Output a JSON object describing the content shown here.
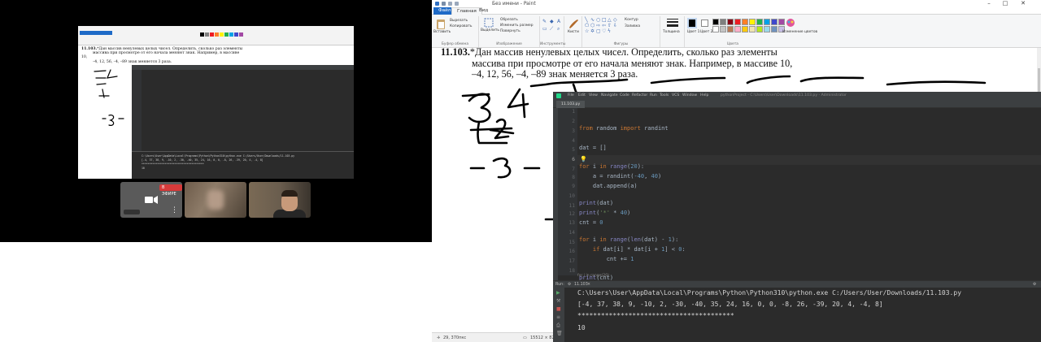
{
  "paint": {
    "title": "Без имени - Paint",
    "tabs": [
      {
        "label": "Файл"
      },
      {
        "label": "Главная"
      },
      {
        "label": "Вид"
      }
    ],
    "ribbon": {
      "paste_label": "Вставить",
      "cut_label": "Вырезать",
      "copy_label": "Копировать",
      "clipboard_group": "Буфер обмена",
      "select_label": "Выделить",
      "crop_label": "Обрезать",
      "resize_label": "Изменить размер",
      "rotate_label": "Повернуть",
      "image_group": "Изображение",
      "tools_group": "Инструменты",
      "brushes_label": "Кисти",
      "outline_label": "Контур",
      "fill_label": "Заливка",
      "shapes_group": "Фигуры",
      "thickness_label": "Толщина",
      "color1_label": "Цвет 1",
      "color2_label": "Цвет 2",
      "edit_colors_label": "Изменение цветов",
      "colors_group": "Цвета",
      "palette": [
        "#000000",
        "#7f7f7f",
        "#880015",
        "#ed1c24",
        "#ff7f27",
        "#fff200",
        "#22b14c",
        "#00a2e8",
        "#3f48cc",
        "#a349a4",
        "#ffffff",
        "#c3c3c3",
        "#b97a57",
        "#ffaec9",
        "#ffc90e",
        "#efe4b0",
        "#b5e61d",
        "#99d9ea",
        "#7092be",
        "#c8bfe7"
      ]
    },
    "task": {
      "number": "11.103.",
      "line1": "*Дан массив ненулевых целых чисел. Определить, сколько раз элементы",
      "line2": "массива при просмотре от его начала меняют знак. Например, в массиве 10,",
      "line3": "–4, 12, 56, –4, –89 знак меняется 3 раза."
    },
    "status": {
      "cursor": "29, 370пкс",
      "selection": "15512 × 8210"
    }
  },
  "ide": {
    "menu": [
      "File",
      "Edit",
      "View",
      "Navigate",
      "Code",
      "Refactor",
      "Run",
      "Tools",
      "VCS",
      "Window",
      "Help"
    ],
    "project_title": "pythonProject - C:\\Users\\User\\Downloads\\11.103.py - Administrator",
    "file_tab": "11.103.py",
    "line_numbers": [
      "1",
      "2",
      "3",
      "4",
      "5",
      "6",
      "7",
      "8",
      "9",
      "10",
      "11",
      "12",
      "13",
      "14",
      "15",
      "16",
      "17",
      "18"
    ],
    "breadcrumb": "for i in range(20)",
    "run_label": "Run:",
    "run_config": "11.103",
    "output": {
      "command": "C:\\Users\\User\\AppData\\Local\\Programs\\Python\\Python310\\python.exe C:/Users/User/Downloads/11.103.py",
      "array": "[-4, 37, 38, 9, -10, 2, -30, -40, 35, 24, 16, 0, 0, -8, 26, -39, 20, 4, -4, 8]",
      "stars": "****************************************",
      "result": "10"
    }
  },
  "call": {
    "live_badge": "В ЭФИРЕ",
    "mini_task": {
      "number": "11.103.",
      "line1": "*Дан массив ненулевых целых чисел. Определить, сколько раз элементы",
      "line2": "массива при просмотре от его начала меняют знак. Например, в массиве 10,",
      "line3": "–4, 12, 56, –4, –89 знак меняется 3 раза."
    }
  }
}
